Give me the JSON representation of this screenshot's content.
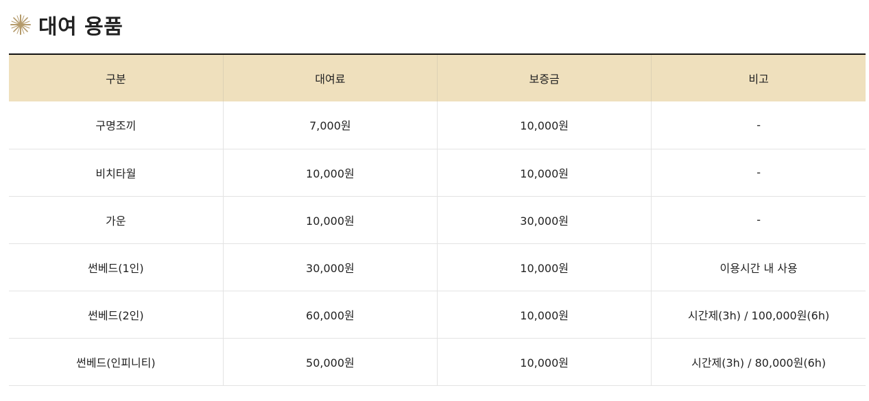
{
  "section": {
    "title": "대여 용품"
  },
  "colors": {
    "header_bg": "#efe0bd",
    "accent_star": "#b49a6a",
    "top_border": "#111111",
    "row_border": "#e3e3e3"
  },
  "table": {
    "headers": [
      "구분",
      "대여료",
      "보증금",
      "비고"
    ],
    "rows": [
      [
        "구명조끼",
        "7,000원",
        "10,000원",
        "-"
      ],
      [
        "비치타월",
        "10,000원",
        "10,000원",
        "-"
      ],
      [
        "가운",
        "10,000원",
        "30,000원",
        "-"
      ],
      [
        "썬베드(1인)",
        "30,000원",
        "10,000원",
        "이용시간 내 사용"
      ],
      [
        "썬베드(2인)",
        "60,000원",
        "10,000원",
        "시간제(3h) / 100,000원(6h)"
      ],
      [
        "썬베드(인피니티)",
        "50,000원",
        "10,000원",
        "시간제(3h) / 80,000원(6h)"
      ]
    ]
  },
  "icons": {
    "title_icon": "sparkle-star-icon"
  }
}
